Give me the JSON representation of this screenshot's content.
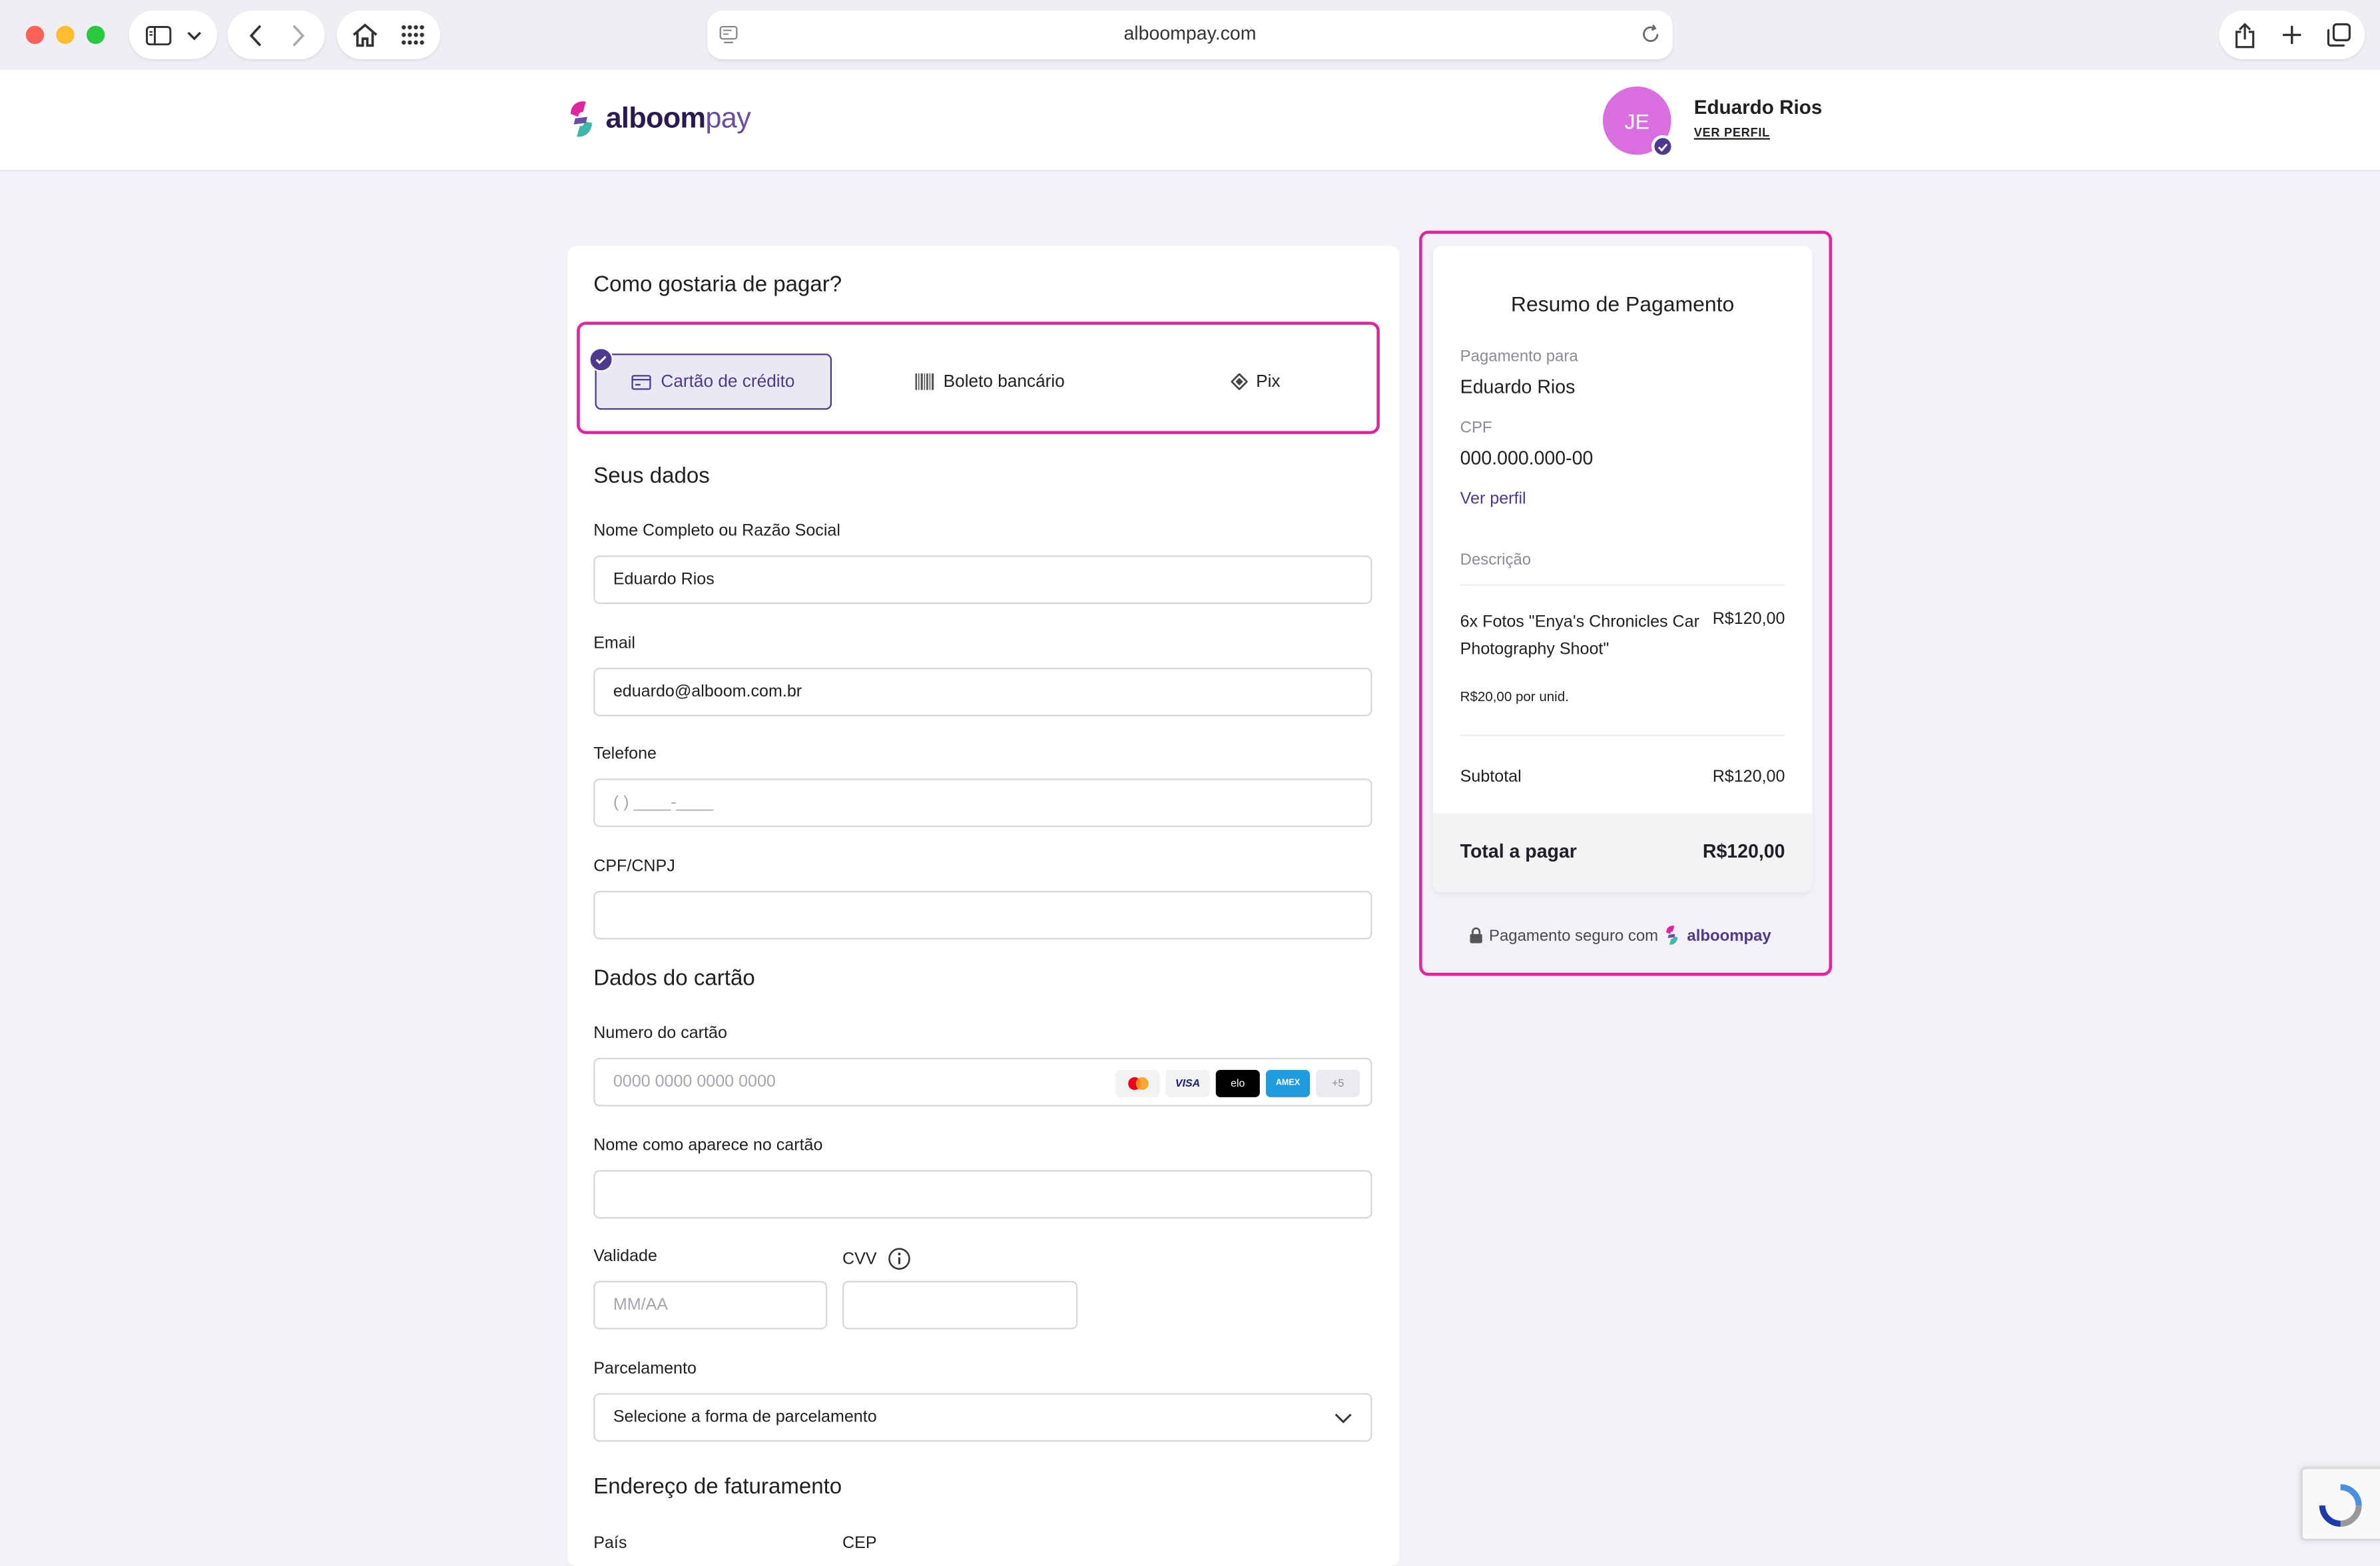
{
  "browser": {
    "url": "alboompay.com"
  },
  "header": {
    "logo_main": "alboom",
    "logo_sub": "pay",
    "avatar_initials": "JE",
    "user_name": "Eduardo Rios",
    "profile_link": "VER PERFIL"
  },
  "payment": {
    "question": "Como gostaria de pagar?",
    "methods": [
      {
        "label": "Cartão de crédito",
        "selected": true
      },
      {
        "label": "Boleto bancário",
        "selected": false
      },
      {
        "label": "Pix",
        "selected": false
      }
    ]
  },
  "personal": {
    "title": "Seus dados",
    "name_label": "Nome Completo ou Razão Social",
    "name_value": "Eduardo Rios",
    "email_label": "Email",
    "email_value": "eduardo@alboom.com.br",
    "phone_label": "Telefone",
    "phone_placeholder": "( ) ____-____",
    "doc_label": "CPF/CNPJ",
    "doc_value": ""
  },
  "card": {
    "title": "Dados do cartão",
    "number_label": "Numero do cartão",
    "number_placeholder": "0000 0000 0000 0000",
    "brands": [
      "mastercard",
      "VISA",
      "elo",
      "AMEX",
      "+5"
    ],
    "holder_label": "Nome como aparece no cartão",
    "expiry_label": "Validade",
    "expiry_placeholder": "MM/AA",
    "cvv_label": "CVV",
    "installments_label": "Parcelamento",
    "installments_value": "Selecione a forma de parcelamento"
  },
  "billing": {
    "title": "Endereço de faturamento",
    "country_label": "País",
    "zip_label": "CEP"
  },
  "summary": {
    "title": "Resumo de Pagamento",
    "payee_label": "Pagamento para",
    "payee_name": "Eduardo Rios",
    "cpf_label": "CPF",
    "cpf_value": "000.000.000-00",
    "profile_link": "Ver perfil",
    "description_label": "Descrição",
    "item_description": "6x Fotos \"Enya's Chronicles Car Photography Shoot\"",
    "item_price": "R$120,00",
    "unit_price": "R$20,00",
    "unit_suffix": "por unid.",
    "subtotal_label": "Subtotal",
    "subtotal_value": "R$120,00",
    "total_label": "Total a pagar",
    "total_value": "R$120,00",
    "secure_text": "Pagamento seguro com",
    "secure_brand": "alboompay"
  },
  "colors": {
    "brand_purple": "#4d3a8c",
    "highlight_pink": "#e0249e",
    "avatar_pink": "#d86ee0"
  }
}
